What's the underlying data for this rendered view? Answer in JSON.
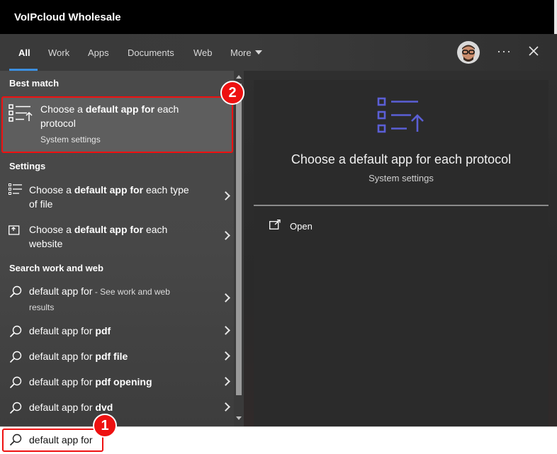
{
  "window": {
    "title": "VoIPcloud Wholesale"
  },
  "tabs": [
    {
      "label": "All",
      "active": true
    },
    {
      "label": "Work"
    },
    {
      "label": "Apps"
    },
    {
      "label": "Documents"
    },
    {
      "label": "Web"
    },
    {
      "label": "More"
    }
  ],
  "toolbar": {
    "more_options": "···"
  },
  "sections": {
    "best_match": "Best match",
    "settings": "Settings",
    "search_web": "Search work and web"
  },
  "best_match": {
    "line1_prefix": "Choose a ",
    "line1_bold": "default app for",
    "line1_suffix": " each",
    "line2": "protocol",
    "subtitle": "System settings"
  },
  "settings_results": [
    {
      "prefix": "Choose a ",
      "bold": "default app for",
      "suffix": " each type",
      "line2": "of file"
    },
    {
      "prefix": "Choose a ",
      "bold": "default app for",
      "suffix": " each",
      "line2": "website"
    }
  ],
  "web_results": [
    {
      "query": "default app for",
      "bold": "",
      "extra": " - See work and web",
      "line2": "results"
    },
    {
      "query": "default app for ",
      "bold": "pdf"
    },
    {
      "query": "default app for ",
      "bold": "pdf file"
    },
    {
      "query": "default app for ",
      "bold": "pdf opening"
    },
    {
      "query": "default app for ",
      "bold": "dvd"
    }
  ],
  "preview": {
    "title": "Choose a default app for each protocol",
    "subtitle": "System settings",
    "action_open": "Open"
  },
  "search": {
    "value": "default app for"
  },
  "badges": {
    "one": "1",
    "two": "2"
  },
  "colors": {
    "accent": "#3c8fe0",
    "highlight": "#ee1111",
    "icon_purple": "#5b5fd6"
  }
}
